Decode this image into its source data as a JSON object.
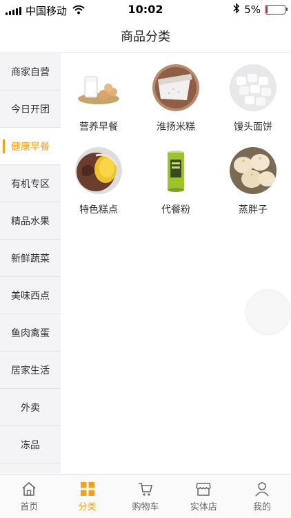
{
  "status_bar": {
    "carrier": "中国移动",
    "time": "10:02",
    "battery": "5%",
    "battery_level": 0.05
  },
  "nav": {
    "title": "商品分类"
  },
  "sidebar": {
    "items": [
      {
        "label": "商家自营",
        "active": false
      },
      {
        "label": "今日开团",
        "active": false
      },
      {
        "label": "健康早餐",
        "active": true
      },
      {
        "label": "有机专区",
        "active": false
      },
      {
        "label": "精品水果",
        "active": false
      },
      {
        "label": "新鲜蔬菜",
        "active": false
      },
      {
        "label": "美味西点",
        "active": false
      },
      {
        "label": "鱼肉禽蛋",
        "active": false
      },
      {
        "label": "居家生活",
        "active": false
      },
      {
        "label": "外卖",
        "active": false
      },
      {
        "label": "冻品",
        "active": false
      }
    ]
  },
  "categories": [
    {
      "label": "营养早餐",
      "icon": "milk-eggs-image"
    },
    {
      "label": "淮扬米糕",
      "icon": "rice-cake-image"
    },
    {
      "label": "馒头面饼",
      "icon": "steamed-bun-image"
    },
    {
      "label": "特色糕点",
      "icon": "pastry-image"
    },
    {
      "label": "代餐粉",
      "icon": "meal-powder-can-image"
    },
    {
      "label": "蒸胖子",
      "icon": "dumplings-image"
    }
  ],
  "tabbar": {
    "items": [
      {
        "label": "首页",
        "icon": "home-icon",
        "active": false
      },
      {
        "label": "分类",
        "icon": "category-icon",
        "active": true
      },
      {
        "label": "购物车",
        "icon": "cart-icon",
        "active": false
      },
      {
        "label": "实体店",
        "icon": "store-icon",
        "active": false
      },
      {
        "label": "我的",
        "icon": "user-icon",
        "active": false
      }
    ]
  },
  "colors": {
    "accent": "#f0a21b",
    "battery_low": "#e02020",
    "sidebar_bg": "#f4f4f6"
  }
}
